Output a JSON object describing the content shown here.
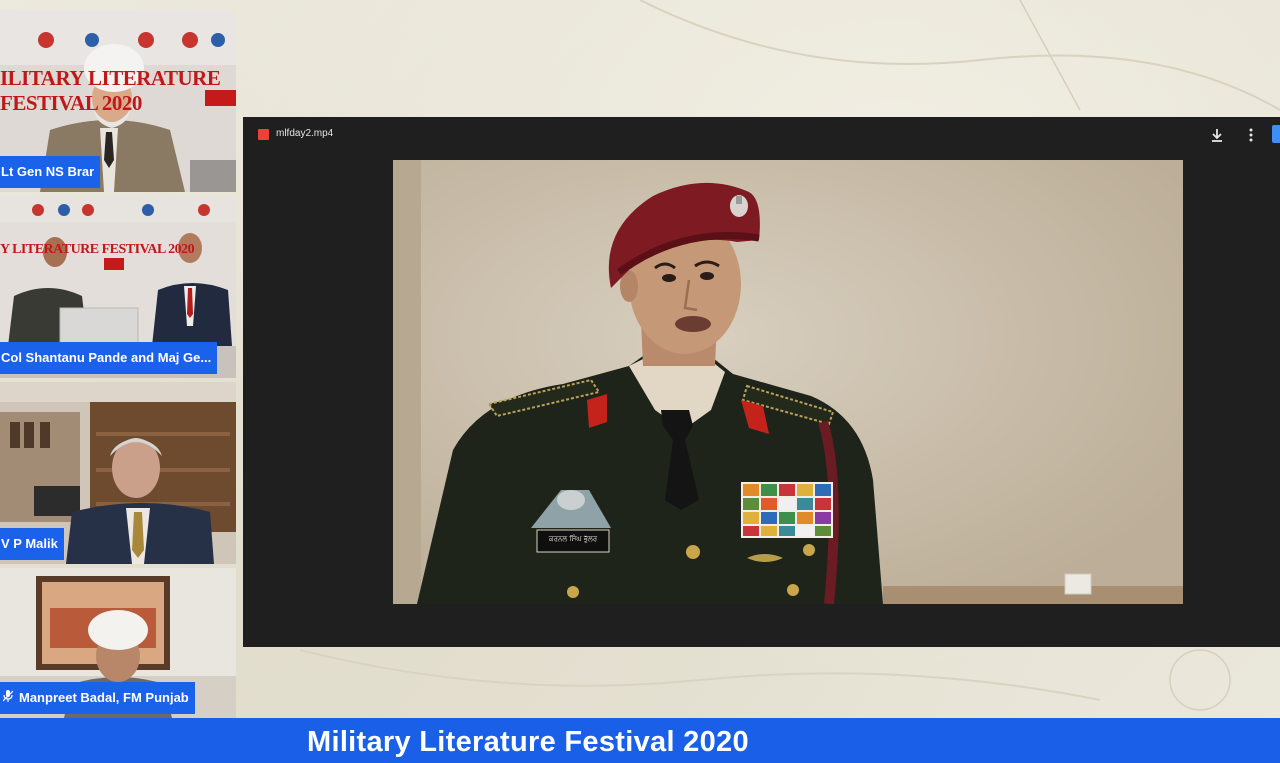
{
  "participants": [
    {
      "name": "Lt Gen NS Brar",
      "banner_text": "ILITARY LITERATURE FESTIVAL 2020"
    },
    {
      "name": "Col Shantanu Pande and Maj Ge...",
      "banner_text": "Y LITERATURE FESTIVAL 2020"
    },
    {
      "name": "V P Malik"
    },
    {
      "name": "Manpreet Badal, FM Punjab",
      "muted": true
    }
  ],
  "player": {
    "file_name": "mlfday2.mp4",
    "badge_text": "ਕਰਨਲ ਸਿੰਘ ਭੁੱਲਰ"
  },
  "footer": {
    "title": "Military Literature Festival 2020"
  },
  "colors": {
    "accent_blue": "#1a62ea",
    "player_bg": "#1f1f1f",
    "beret": "#7d1a22"
  }
}
